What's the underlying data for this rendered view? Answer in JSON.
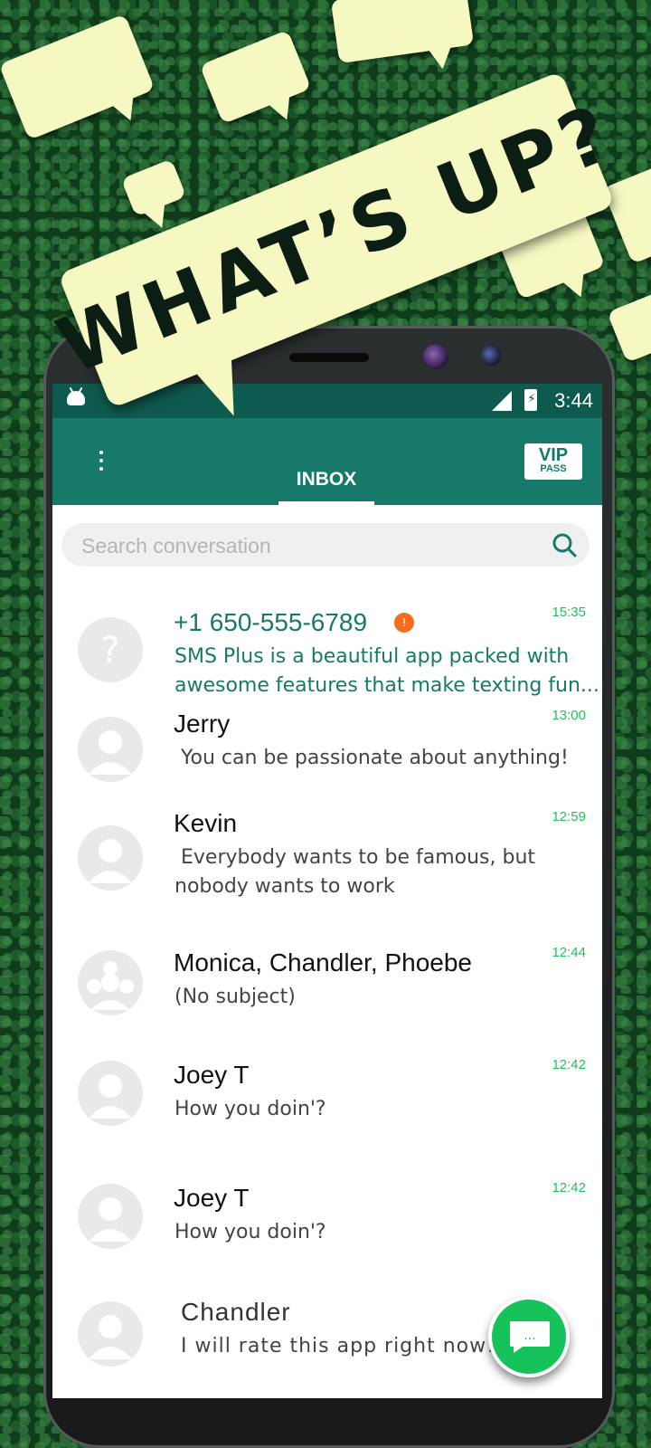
{
  "promo": {
    "headline": "WHAT’S UP?"
  },
  "status_bar": {
    "time": "3:44",
    "battery_glyph": "⚡"
  },
  "app_bar": {
    "tab_inbox": "INBOX",
    "vip_top": "VIP",
    "vip_bottom": "PASS"
  },
  "search": {
    "placeholder": "Search conversation"
  },
  "conversations": [
    {
      "name": "+1 650-555-6789",
      "preview": "SMS Plus is a beautiful app packed with awesome features that make texting fun...",
      "time": "15:35",
      "unread": true,
      "avatar": "unknown-contact-icon"
    },
    {
      "name": "Jerry",
      "preview": "You can be passionate about anything!",
      "time": "13:00",
      "avatar": "person-icon"
    },
    {
      "name": "Kevin",
      "preview": "Everybody wants to be famous, but nobody wants to work",
      "time": "12:59",
      "avatar": "person-icon"
    },
    {
      "name": "Monica, Chandler, Phoebe",
      "preview": "(No subject)",
      "time": "12:44",
      "avatar": "group-icon"
    },
    {
      "name": "Joey T",
      "preview": "How you doin'?",
      "time": "12:42",
      "avatar": "person-icon"
    },
    {
      "name": "Joey T",
      "preview": "How you doin'?",
      "time": "12:42",
      "avatar": "person-icon"
    },
    {
      "name": "Chandler",
      "preview": "I will rate this app right now!",
      "time": "",
      "avatar": "person-icon"
    }
  ],
  "colors": {
    "status_bar": "#0f5a4e",
    "app_bar": "#17796a",
    "accent_green": "#20c25a",
    "unread_badge": "#f36d22",
    "bubble": "#f6f8c2"
  },
  "fab": {
    "icon": "compose-message-icon",
    "glyph": "..."
  }
}
